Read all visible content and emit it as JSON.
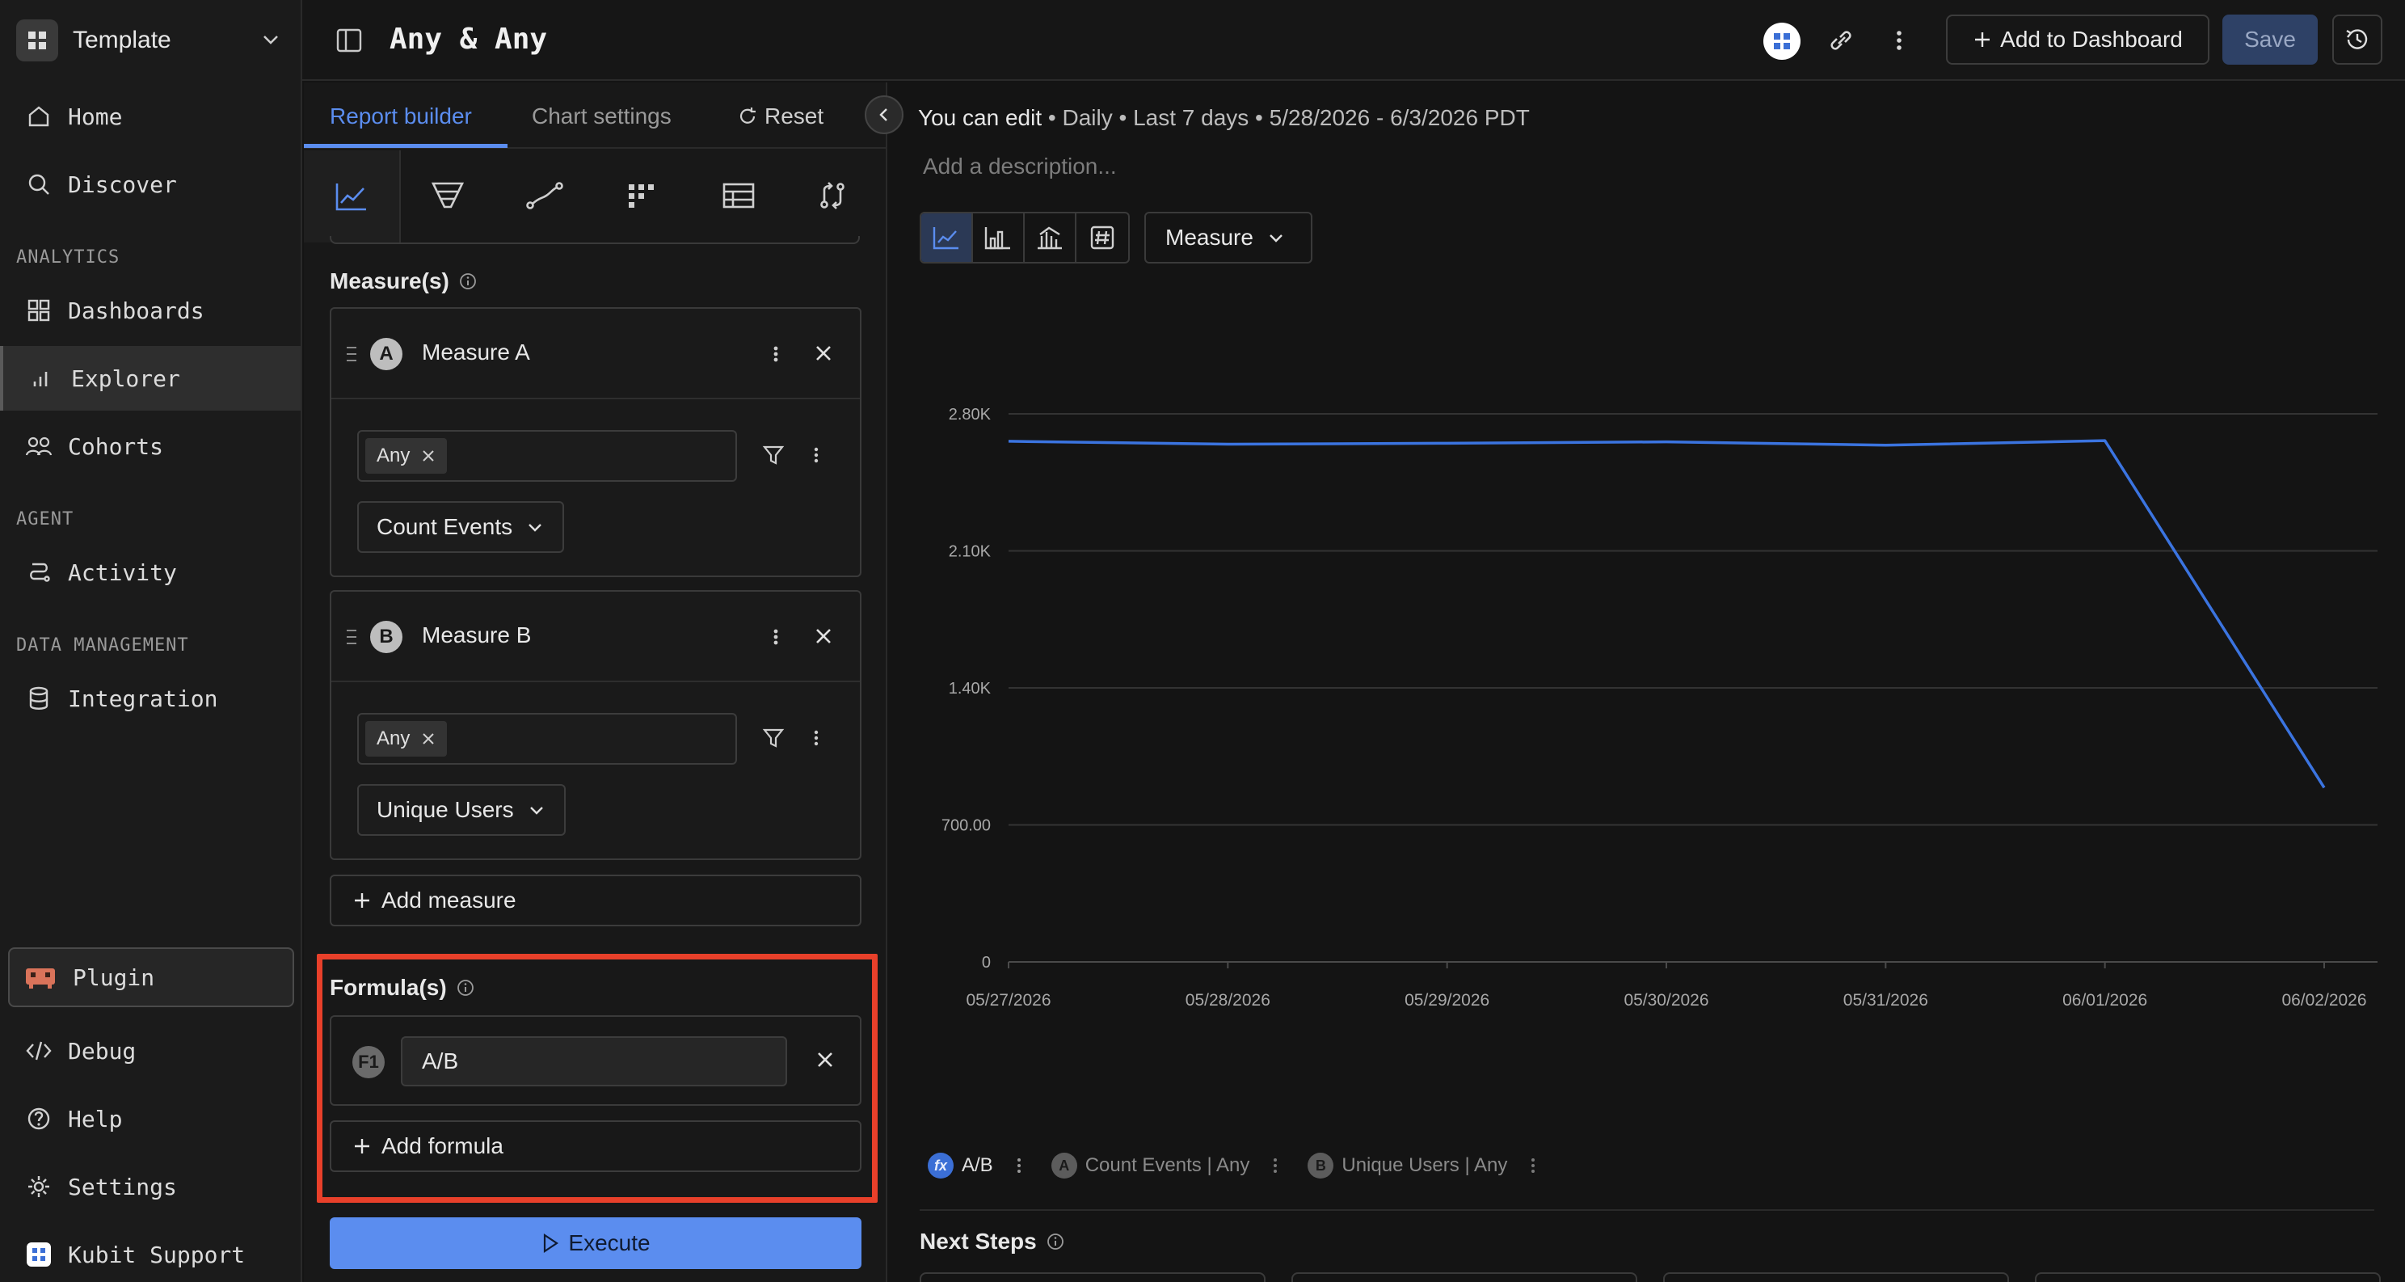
{
  "workspace": {
    "name": "Template"
  },
  "nav": {
    "home": "Home",
    "discover": "Discover",
    "analytics_section": "ANALYTICS",
    "dashboards": "Dashboards",
    "explorer": "Explorer",
    "cohorts": "Cohorts",
    "agent_section": "AGENT",
    "activity": "Activity",
    "data_section": "DATA MANAGEMENT",
    "integration": "Integration",
    "plugin": "Plugin",
    "debug": "Debug",
    "help": "Help",
    "settings": "Settings",
    "support": "Kubit Support"
  },
  "header": {
    "title": "Any & Any",
    "add_to_dashboard": "Add to Dashboard",
    "save": "Save"
  },
  "builder": {
    "tab_report": "Report builder",
    "tab_chart": "Chart settings",
    "reset": "Reset",
    "measures_title": "Measure(s)",
    "measures": [
      {
        "letter": "A",
        "name": "Measure A",
        "chip": "Any",
        "aggregation": "Count Events"
      },
      {
        "letter": "B",
        "name": "Measure B",
        "chip": "Any",
        "aggregation": "Unique Users"
      }
    ],
    "add_measure": "Add measure",
    "formulas_title": "Formula(s)",
    "formula": {
      "badge": "F1",
      "value": "A/B"
    },
    "add_formula": "Add formula",
    "execute": "Execute"
  },
  "main": {
    "meta_edit": "You can edit",
    "meta_rest": " • Daily • Last 7 days • 5/28/2026 - 6/3/2026 PDT",
    "description_placeholder": "Add a description...",
    "measure_dropdown": "Measure",
    "next_steps": "Next Steps"
  },
  "legend": [
    {
      "badge": "fx",
      "label": "A/B",
      "color": "#3b6fd6",
      "active": true
    },
    {
      "badge": "A",
      "label": "Count Events | Any",
      "color": "#6a6a6a",
      "active": false
    },
    {
      "badge": "B",
      "label": "Unique Users | Any",
      "color": "#6a6a6a",
      "active": false
    }
  ],
  "colors": {
    "accent": "#5b8def",
    "line": "#3b74e0",
    "highlight": "#e8402a"
  },
  "chart_data": {
    "type": "line",
    "categories": [
      "05/27/2026",
      "05/28/2026",
      "05/29/2026",
      "05/30/2026",
      "05/31/2026",
      "06/01/2026",
      "06/02/2026"
    ],
    "series": [
      {
        "name": "A/B",
        "values": [
          2660,
          2645,
          2650,
          2657,
          2640,
          2663,
          890
        ]
      }
    ],
    "y_ticks": [
      "0",
      "700.00",
      "1.40K",
      "2.10K",
      "2.80K"
    ],
    "ylim": [
      0,
      2800
    ],
    "grid": true
  }
}
